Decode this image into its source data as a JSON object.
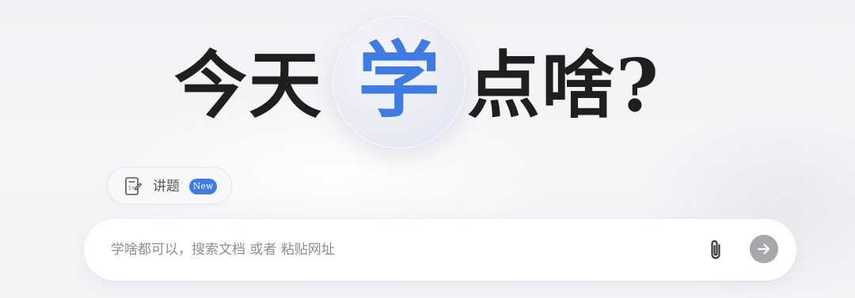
{
  "headline": {
    "left": "今天",
    "accent": "学",
    "right": "点啥?"
  },
  "mode_pill": {
    "icon": "homework-sheet-icon",
    "label": "讲题",
    "badge": "New"
  },
  "search": {
    "placeholder": "学啥都可以，搜索文档 或者 粘贴网址",
    "value": "",
    "attach_icon": "paperclip-icon",
    "send_icon": "arrow-right-icon"
  },
  "colors": {
    "accent": "#3f7be0",
    "send_button": "#a7a8ac",
    "headline_text": "#1f1f1f"
  }
}
